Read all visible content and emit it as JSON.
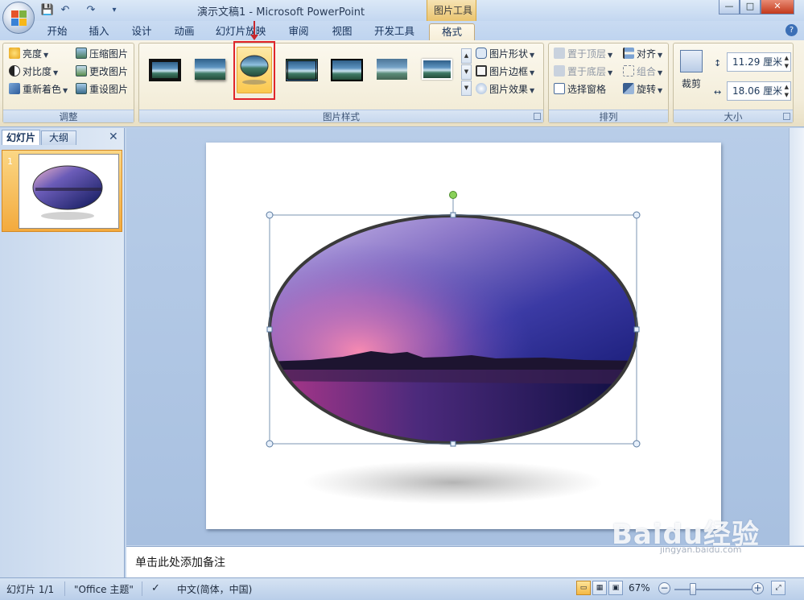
{
  "window": {
    "title": "演示文稿1 - Microsoft PowerPoint",
    "context_tool": "图片工具",
    "controls": {
      "minimize": "—",
      "maximize": "□",
      "close": "✕"
    }
  },
  "qat": {
    "save": "💾",
    "undo": "↶",
    "redo": "↷",
    "more": "▾"
  },
  "tabs": [
    {
      "label": "开始"
    },
    {
      "label": "插入"
    },
    {
      "label": "设计"
    },
    {
      "label": "动画"
    },
    {
      "label": "幻灯片放映"
    },
    {
      "label": "审阅"
    },
    {
      "label": "视图"
    },
    {
      "label": "开发工具"
    },
    {
      "label": "格式"
    }
  ],
  "help": "?",
  "ribbon": {
    "adjust": {
      "label": "调整",
      "brightness": "亮度",
      "contrast": "对比度",
      "recolor": "重新着色",
      "compress": "压缩图片",
      "change": "更改图片",
      "reset": "重设图片"
    },
    "styles": {
      "label": "图片样式",
      "shape": "图片形状",
      "border": "图片边框",
      "effects": "图片效果"
    },
    "arrange": {
      "label": "排列",
      "bring_front": "置于顶层",
      "send_back": "置于底层",
      "selection_pane": "选择窗格",
      "align": "对齐",
      "group": "组合",
      "rotate": "旋转"
    },
    "size": {
      "label": "大小",
      "crop": "裁剪",
      "height": "11.29 厘米",
      "width": "18.06 厘米"
    }
  },
  "left_pane": {
    "tab_slides": "幻灯片",
    "tab_outline": "大纲",
    "close": "✕",
    "slide_number": "1"
  },
  "notes": {
    "placeholder": "单击此处添加备注"
  },
  "status": {
    "slide": "幻灯片 1/1",
    "theme": "\"Office 主题\"",
    "language": "中文(简体，中国)",
    "zoom": "67%",
    "zoom_fraction": 0.24
  },
  "watermark": {
    "text": "Baidu经验",
    "sub": "jingyan.baidu.com"
  },
  "colors": {
    "accent_red": "#c8262b",
    "selected_tab": "#f6eed8",
    "context_tab": "#eac46f"
  }
}
